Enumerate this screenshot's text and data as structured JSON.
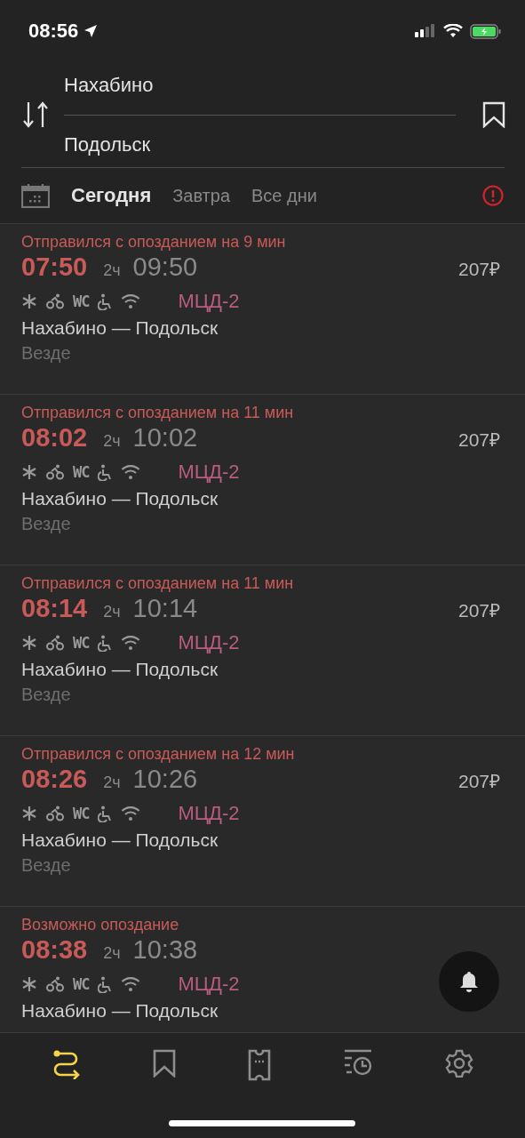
{
  "status_bar": {
    "time": "08:56"
  },
  "route": {
    "from": "Нахабино",
    "to": "Подольск"
  },
  "date_tabs": [
    {
      "label": "Сегодня",
      "selected": true
    },
    {
      "label": "Завтра",
      "selected": false
    },
    {
      "label": "Все дни",
      "selected": false
    }
  ],
  "trains": [
    {
      "status": "Отправился с опозданием на 9 мин",
      "departure": "07:50",
      "duration": "2ч",
      "arrival": "09:50",
      "price": "207₽",
      "amenity_wc": "WC",
      "line": "МЦД-2",
      "route": "Нахабино — Подольск",
      "stops": "Везде"
    },
    {
      "status": "Отправился с опозданием на 11 мин",
      "departure": "08:02",
      "duration": "2ч",
      "arrival": "10:02",
      "price": "207₽",
      "amenity_wc": "WC",
      "line": "МЦД-2",
      "route": "Нахабино — Подольск",
      "stops": "Везде"
    },
    {
      "status": "Отправился с опозданием на 11 мин",
      "departure": "08:14",
      "duration": "2ч",
      "arrival": "10:14",
      "price": "207₽",
      "amenity_wc": "WC",
      "line": "МЦД-2",
      "route": "Нахабино — Подольск",
      "stops": "Везде"
    },
    {
      "status": "Отправился с опозданием на 12 мин",
      "departure": "08:26",
      "duration": "2ч",
      "arrival": "10:26",
      "price": "207₽",
      "amenity_wc": "WC",
      "line": "МЦД-2",
      "route": "Нахабино — Подольск",
      "stops": "Везде"
    },
    {
      "status": "Возможно опоздание",
      "departure": "08:38",
      "duration": "2ч",
      "arrival": "10:38",
      "amenity_wc": "WC",
      "line": "МЦД-2",
      "route": "Нахабино — Подольск"
    }
  ],
  "bottom_tabs": [
    {
      "kind": "routes",
      "selected": true
    },
    {
      "kind": "bookmarks",
      "selected": false
    },
    {
      "kind": "tickets",
      "selected": false
    },
    {
      "kind": "history",
      "selected": false
    },
    {
      "kind": "settings",
      "selected": false
    }
  ]
}
